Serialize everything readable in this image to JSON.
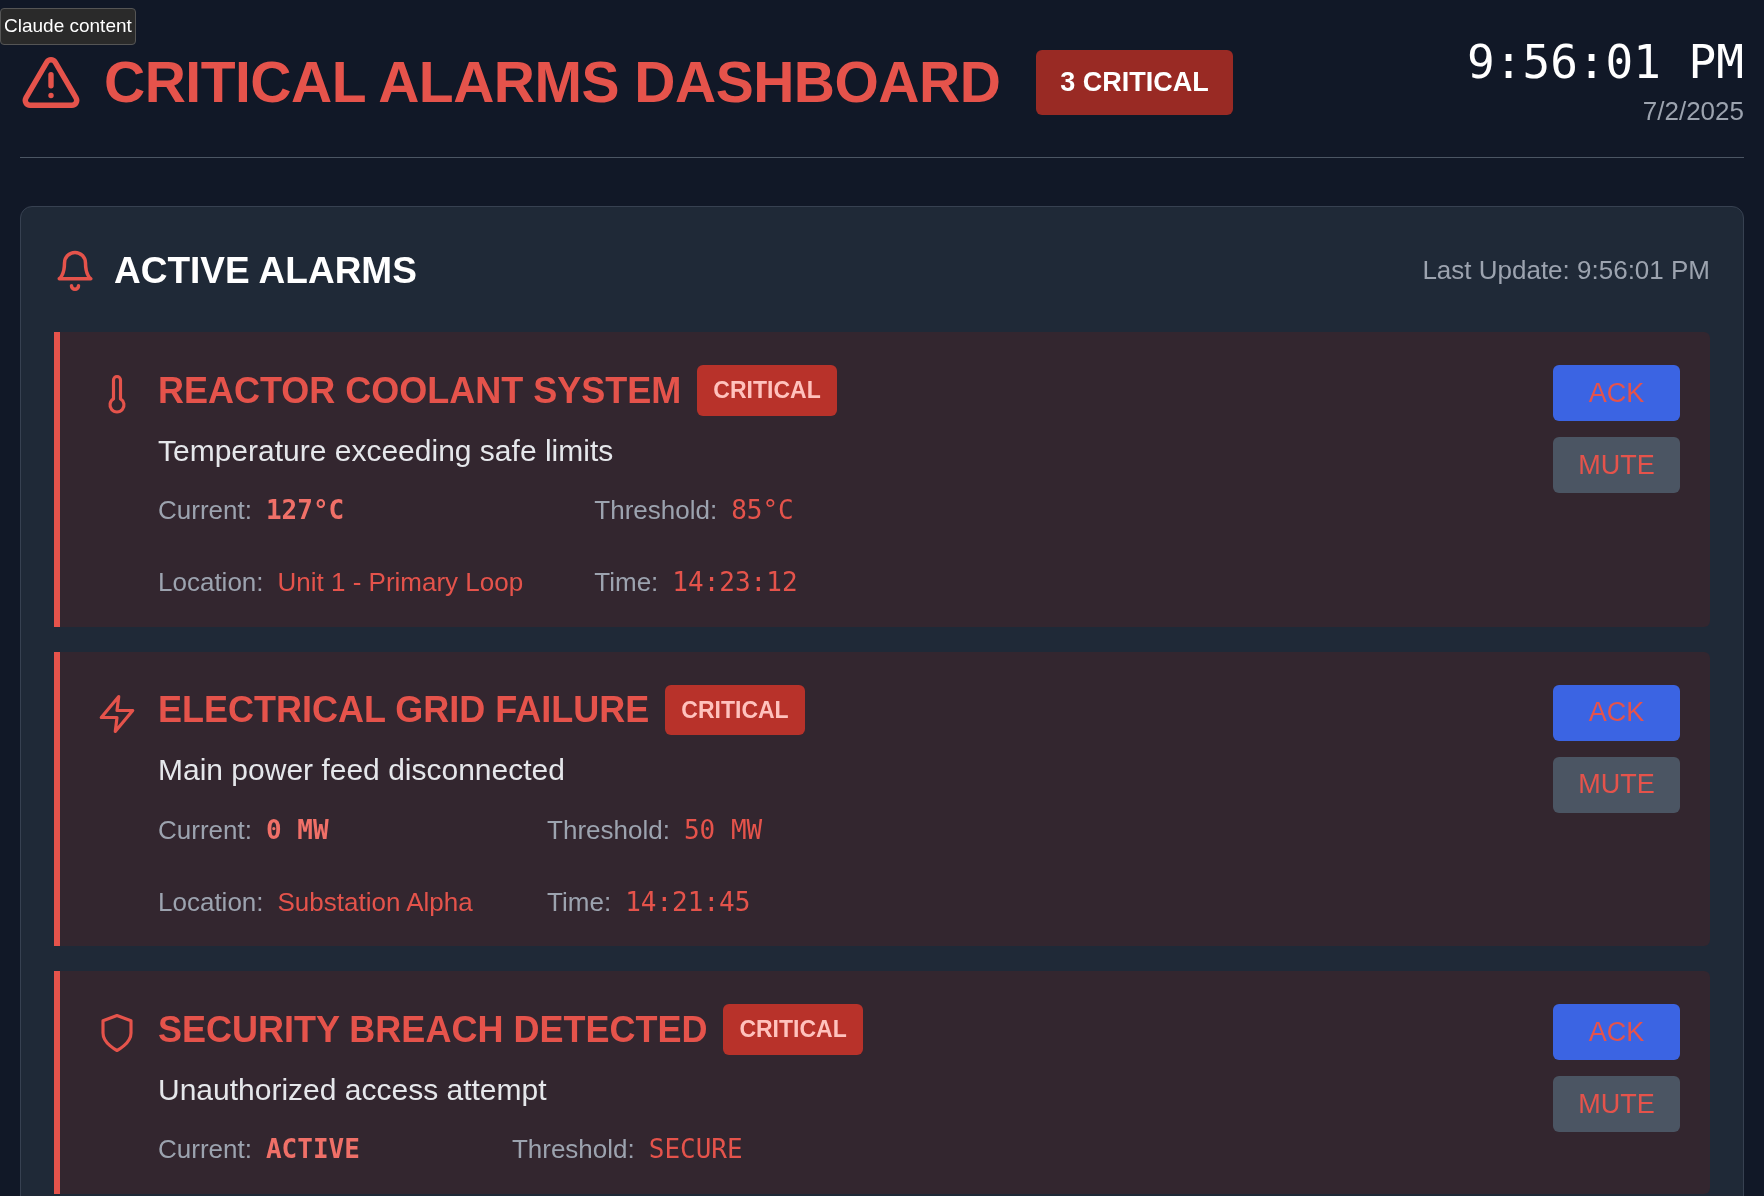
{
  "tooltip": "Claude content",
  "header": {
    "title": "CRITICAL ALARMS DASHBOARD",
    "count_badge": "3 CRITICAL",
    "clock": "9:56:01 PM",
    "date": "7/2/2025"
  },
  "panel": {
    "title": "ACTIVE ALARMS",
    "last_update": "Last Update: 9:56:01 PM",
    "alarms": [
      {
        "kind": "temperature",
        "title": "REACTOR COOLANT SYSTEM",
        "severity": "CRITICAL",
        "description": "Temperature exceeding safe limits",
        "fields": [
          {
            "label": "Current:",
            "value": "127°C",
            "kind": "primary"
          },
          {
            "label": "Threshold:",
            "value": "85°C",
            "kind": "mono"
          },
          {
            "label": "Location:",
            "value": "Unit 1 - Primary Loop",
            "kind": "text"
          },
          {
            "label": "Time:",
            "value": "14:23:12",
            "kind": "mono"
          }
        ],
        "buttons": [
          "ACK",
          "MUTE"
        ]
      },
      {
        "kind": "power",
        "title": "ELECTRICAL GRID FAILURE",
        "severity": "CRITICAL",
        "description": "Main power feed disconnected",
        "fields": [
          {
            "label": "Current:",
            "value": "0 MW",
            "kind": "primary"
          },
          {
            "label": "Threshold:",
            "value": "50 MW",
            "kind": "mono"
          },
          {
            "label": "Location:",
            "value": "Substation Alpha",
            "kind": "text"
          },
          {
            "label": "Time:",
            "value": "14:21:45",
            "kind": "mono"
          }
        ],
        "buttons": [
          "ACK",
          "MUTE"
        ]
      },
      {
        "kind": "security",
        "title": "SECURITY BREACH DETECTED",
        "severity": "CRITICAL",
        "description": "Unauthorized access attempt",
        "fields": [
          {
            "label": "Current:",
            "value": "ACTIVE",
            "kind": "primary"
          },
          {
            "label": "Threshold:",
            "value": "SECURE",
            "kind": "mono"
          }
        ],
        "buttons": [
          "ACK",
          "MUTE"
        ]
      }
    ]
  }
}
